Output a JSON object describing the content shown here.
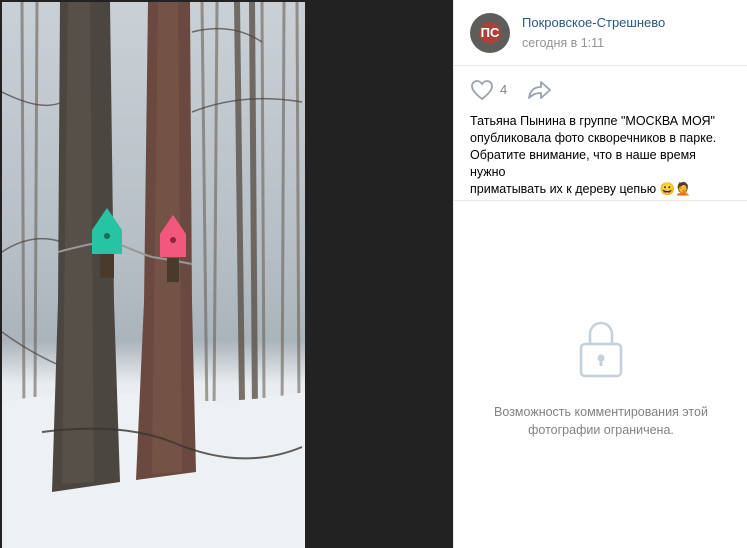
{
  "post": {
    "group_name": "Покровское-Стрешнево",
    "avatar_letters": "ПС",
    "time": "сегодня в 1:11",
    "likes": "4",
    "text": "Татьяна Пынина в группе \"МОСКВА МОЯ\"\nопубликовала фото скворечников в парке.\nОбратите внимание, что в наше время нужно\nприматывать их к дереву цепью 😀🤦"
  },
  "comments": {
    "restricted_message": "Возможность комментирования этой фотографии ограничена."
  },
  "icons": {
    "like": "heart-icon",
    "share": "share-arrow-icon",
    "lock": "lock-icon"
  }
}
